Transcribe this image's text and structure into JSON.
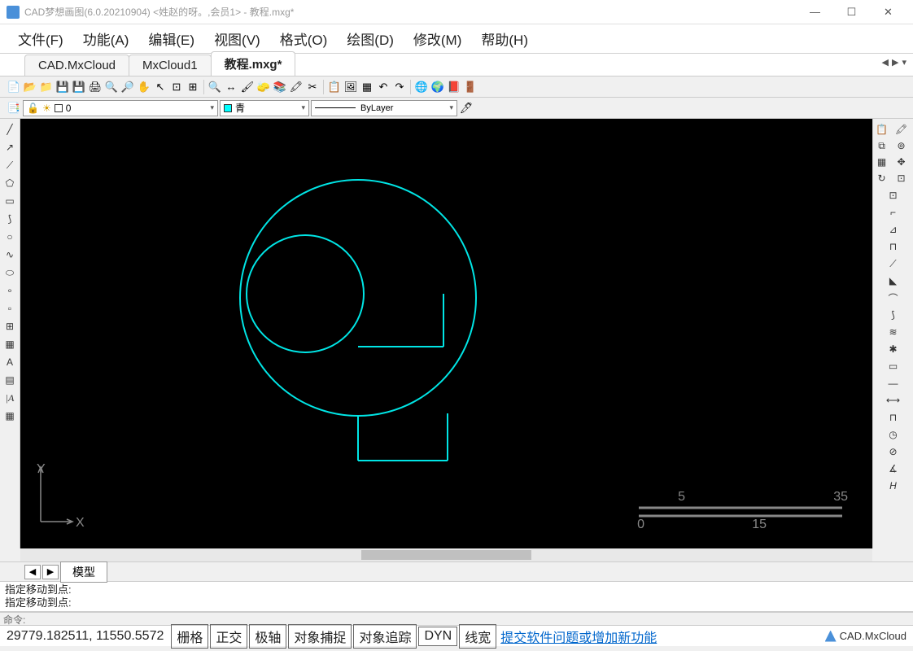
{
  "titlebar": {
    "title": "CAD梦想画图(6.0.20210904) <姓赵的呀。,会员1> - 教程.mxg*"
  },
  "menu": {
    "file": "文件(F)",
    "func": "功能(A)",
    "edit": "编辑(E)",
    "view": "视图(V)",
    "format": "格式(O)",
    "draw": "绘图(D)",
    "modify": "修改(M)",
    "help": "帮助(H)"
  },
  "tabs": {
    "t1": "CAD.MxCloud",
    "t2": "MxCloud1",
    "t3": "教程.mxg*"
  },
  "layer": {
    "name": "0",
    "color": "青",
    "linetype": "ByLayer"
  },
  "canvas": {
    "axis_y": "Y",
    "axis_x": "X",
    "scale_5": "5",
    "scale_35": "35",
    "scale_0": "0",
    "scale_15": "15"
  },
  "bottom_tabs": {
    "model": "模型"
  },
  "cmd": {
    "line1": "指定移动到点:",
    "line2": "指定移动到点:",
    "prompt": "命令:"
  },
  "status": {
    "coords": "29779.182511,  11550.5572",
    "grid": "栅格",
    "ortho": "正交",
    "polar": "极轴",
    "osnap": "对象捕捉",
    "otrack": "对象追踪",
    "dyn": "DYN",
    "lw": "线宽",
    "link": "提交软件问题或增加新功能",
    "brand": "CAD.MxCloud"
  }
}
